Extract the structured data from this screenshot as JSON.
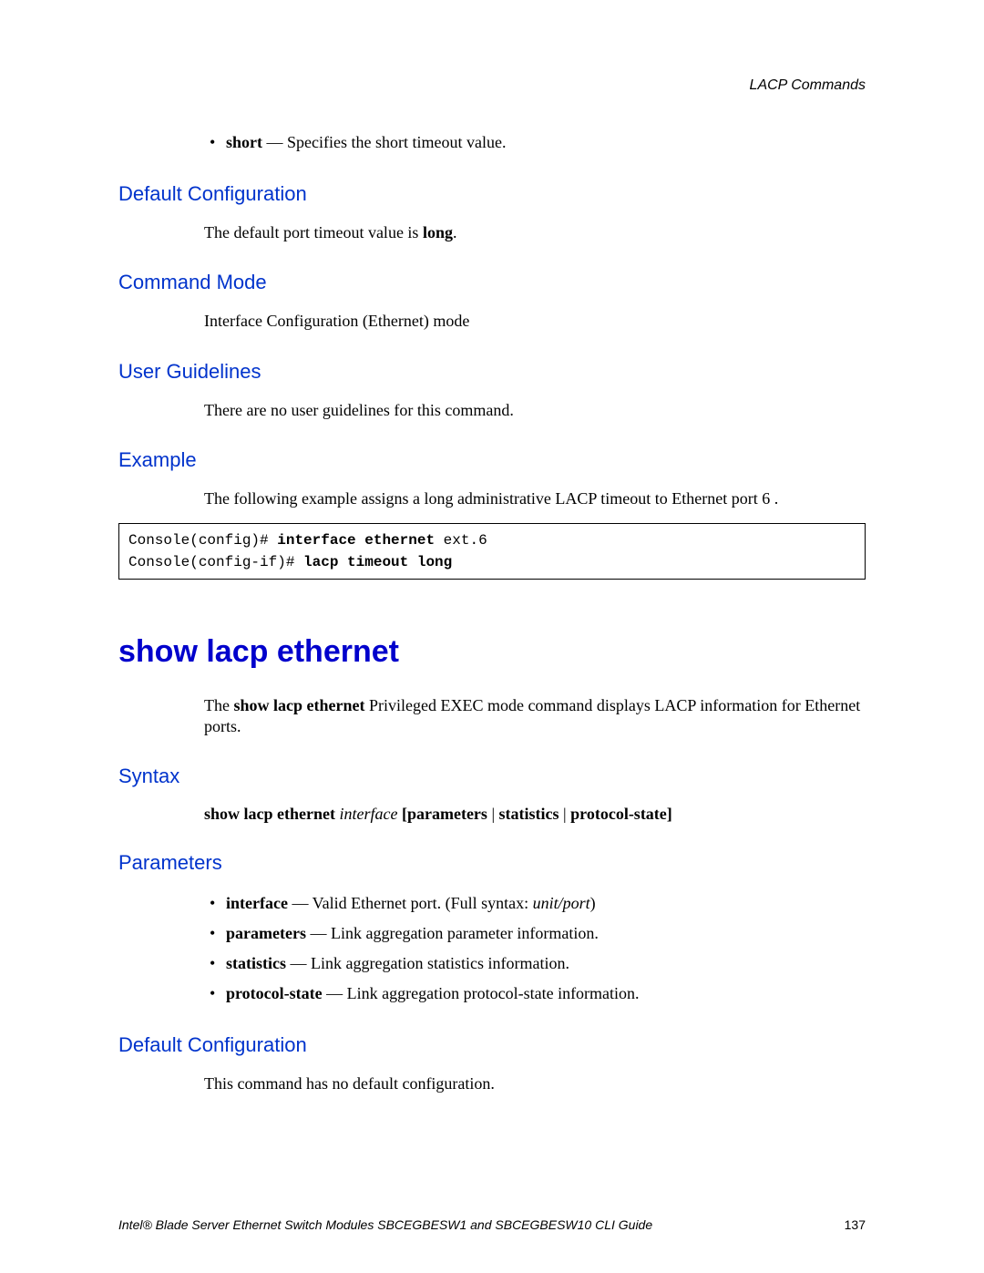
{
  "header": {
    "section": "LACP Commands"
  },
  "topBullet": {
    "keyword": "short",
    "desc": " — Specifies the short timeout value."
  },
  "sections": {
    "defaultConfig1": {
      "heading": "Default Configuration",
      "textPrefix": "The default port timeout value is ",
      "textBold": "long",
      "textSuffix": "."
    },
    "commandMode": {
      "heading": "Command Mode",
      "text": "Interface Configuration (Ethernet) mode"
    },
    "userGuidelines": {
      "heading": "User Guidelines",
      "text": "There are no user guidelines for this command."
    },
    "example": {
      "heading": "Example",
      "text": "The following example assigns a long administrative LACP timeout to Ethernet port 6 .",
      "code": {
        "line1_prefix": "Console(config)# ",
        "line1_bold": "interface ethernet",
        "line1_suffix": " ext.6",
        "line2_prefix": "Console(config-if)# ",
        "line2_bold": "lacp timeout long"
      }
    }
  },
  "mainCommand": {
    "title": "show lacp ethernet",
    "introPrefix": "The ",
    "introBold": "show lacp ethernet",
    "introSuffix": " Privileged EXEC mode command displays LACP information for Ethernet ports."
  },
  "syntax": {
    "heading": "Syntax",
    "bold1": "show lacp ethernet ",
    "italic1": "interface",
    "bold2": " [parameters",
    "plain1": " | ",
    "bold3": "statistics",
    "plain2": " | ",
    "bold4": "protocol-state]"
  },
  "parameters": {
    "heading": "Parameters",
    "items": [
      {
        "keyword": "interface",
        "desc": " — Valid Ethernet port. (Full syntax: ",
        "italic": "unit/port",
        "suffix": ")"
      },
      {
        "keyword": "parameters",
        "desc": " — Link aggregation parameter information.",
        "italic": "",
        "suffix": ""
      },
      {
        "keyword": "statistics",
        "desc": " — Link aggregation statistics information.",
        "italic": "",
        "suffix": ""
      },
      {
        "keyword": "protocol-state",
        "desc": " — Link aggregation protocol-state information.",
        "italic": "",
        "suffix": ""
      }
    ]
  },
  "defaultConfig2": {
    "heading": "Default Configuration",
    "text": "This command has no default configuration."
  },
  "footer": {
    "title": "Intel® Blade Server Ethernet Switch Modules SBCEGBESW1 and SBCEGBESW10 CLI Guide",
    "page": "137"
  }
}
